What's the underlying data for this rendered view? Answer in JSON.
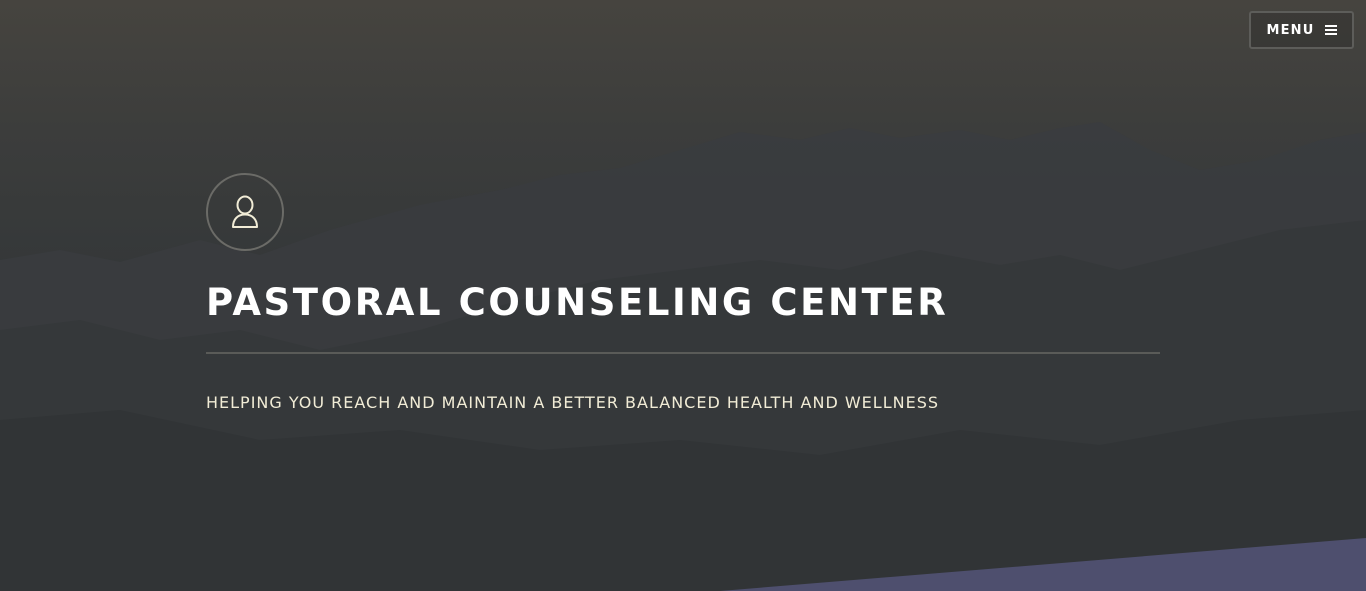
{
  "header": {
    "menu_label": "MENU",
    "menu_icon": "hamburger-icon"
  },
  "hero": {
    "avatar_icon": "user-outline-icon",
    "title": "PASTORAL COUNSELING CENTER",
    "tagline": "HELPING YOU REACH AND MAINTAIN A BETTER BALANCED HEALTH AND WELLNESS"
  },
  "colors": {
    "title_text": "#ffffff",
    "tagline_text": "#f1ecd6",
    "accent_band": "#4e4f6e",
    "overlay": "#2c3133"
  }
}
